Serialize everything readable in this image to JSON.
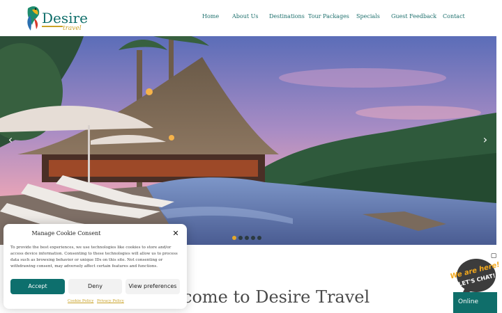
{
  "brand": {
    "name": "Desire",
    "sub": "travel"
  },
  "nav": {
    "items": [
      "Home",
      "About Us",
      "Destinations",
      "Tour Packages",
      "Specials",
      "Guest Feedback",
      "Contact"
    ]
  },
  "slider": {
    "prev_icon": "chevron-left-icon",
    "next_icon": "chevron-right-icon",
    "slide_count": 5,
    "active_slide": 1
  },
  "welcome": {
    "heading": "come to Desire Travel"
  },
  "cookie": {
    "title": "Manage Cookie Consent",
    "body": "To provide the best experiences, we use technologies like cookies to store and/or access device information. Consenting to these technologies will allow us to process data such as browsing behavior or unique IDs on this site. Not consenting or withdrawing consent, may adversely affect certain features and functions.",
    "accept": "Accept",
    "deny": "Deny",
    "preferences": "View preferences",
    "cookie_policy": "Cookie Policy",
    "privacy_policy": "Privacy Policy"
  },
  "chat": {
    "line1": "We are here!",
    "line2": "LET'S CHAT!",
    "status": "Online"
  },
  "colors": {
    "brand_teal": "#0f6e6a",
    "accent_gold": "#c9a227",
    "active_dot": "#e3a82a"
  }
}
